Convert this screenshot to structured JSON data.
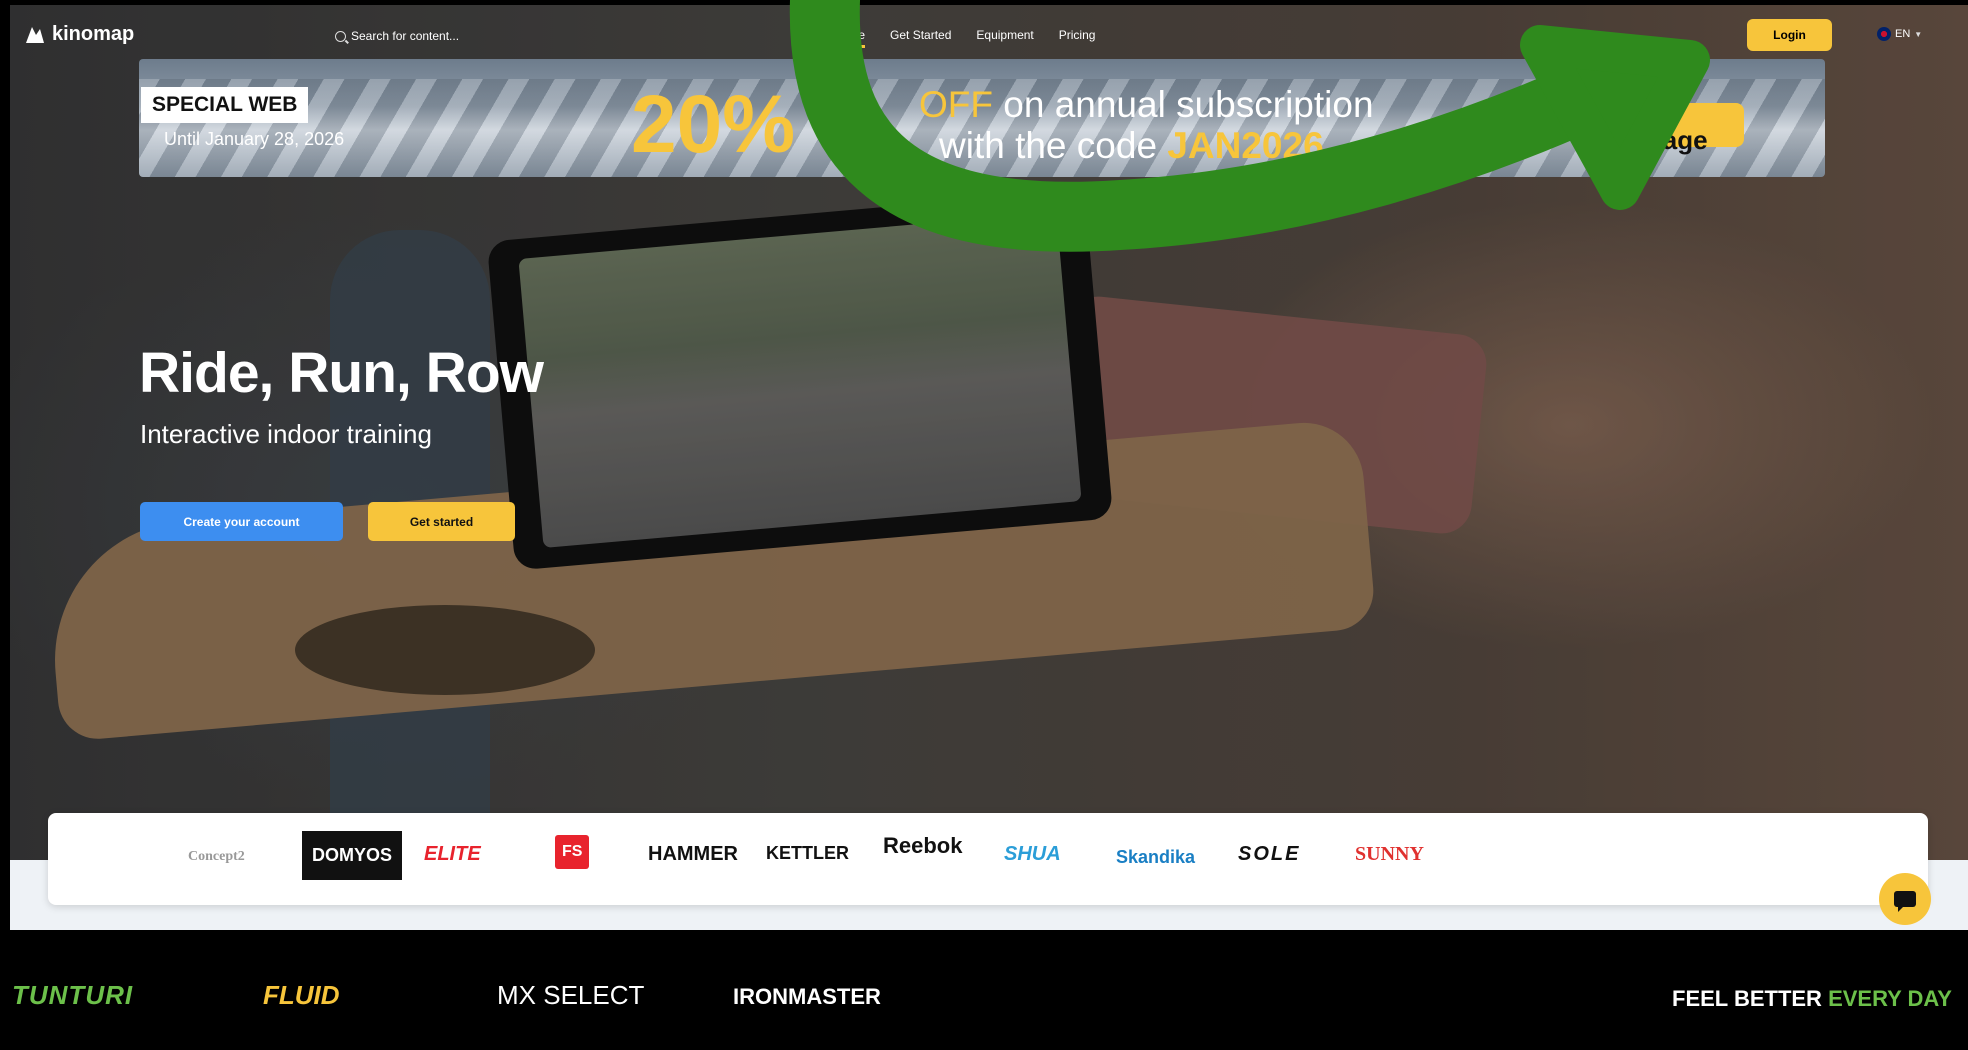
{
  "nav": {
    "logo_text": "kinomap",
    "search_placeholder": "Search for content...",
    "links": [
      "Home",
      "Get Started",
      "Equipment",
      "Pricing"
    ],
    "login_label": "Login",
    "language": "EN"
  },
  "banner": {
    "tag": "SPECIAL WEB",
    "until": "Until January 28, 2026",
    "percent": "20%",
    "line1_off": "OFF",
    "line1_rest": " on annual subscription",
    "line2_prefix": "with the code ",
    "line2_code": "JAN2026",
    "cta": "Take advantage"
  },
  "hero": {
    "title": "Ride, Run, Row",
    "subtitle": "Interactive indoor training",
    "create_button": "Create your account",
    "start_button": "Get started"
  },
  "brands": [
    "Concept2",
    "DOMYOS",
    "ELITE",
    "FS",
    "HAMMER",
    "KETTLER",
    "Reebok",
    "SHUA",
    "Skandika",
    "SOLE",
    "SUNNY"
  ],
  "footer": {
    "brands": [
      "TUNTURI",
      "FLUID",
      "MX SELECT",
      "IRONMASTER"
    ],
    "tagline_white": "FEEL BETTER ",
    "tagline_green": "EVERY DAY"
  },
  "colors": {
    "accent_yellow": "#f7c53b",
    "primary_blue": "#3d8ef0",
    "overlay_green": "#2f8a1d",
    "tagline_green": "#6cc04a"
  }
}
